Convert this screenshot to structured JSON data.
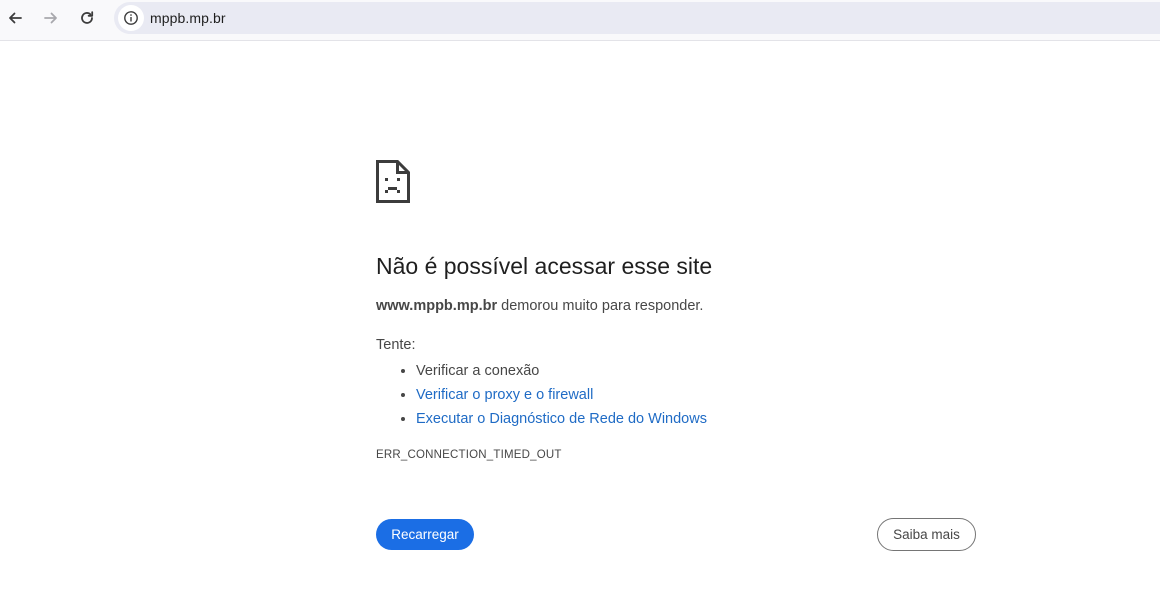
{
  "browser": {
    "url": "mppb.mp.br",
    "icons": {
      "back": "arrow-left-icon",
      "forward": "arrow-right-icon",
      "reload": "reload-icon",
      "site_info": "info-icon"
    }
  },
  "error_page": {
    "heading": "Não é possível acessar esse site",
    "summary_host": "www.mppb.mp.br",
    "summary_text": " demorou muito para responder.",
    "try_label": "Tente:",
    "suggestions": [
      "Verificar a conexão",
      "Verificar o proxy e o firewall",
      "Executar o Diagnóstico de Rede do Windows"
    ],
    "error_code": "ERR_CONNECTION_TIMED_OUT",
    "reload_button": "Recarregar",
    "details_button": "Saiba mais",
    "icon": "sad-document-icon"
  },
  "colors": {
    "primary_button": "#1b6ee5",
    "link": "#1f6bc5",
    "omnibox": "#e9eaf3"
  }
}
